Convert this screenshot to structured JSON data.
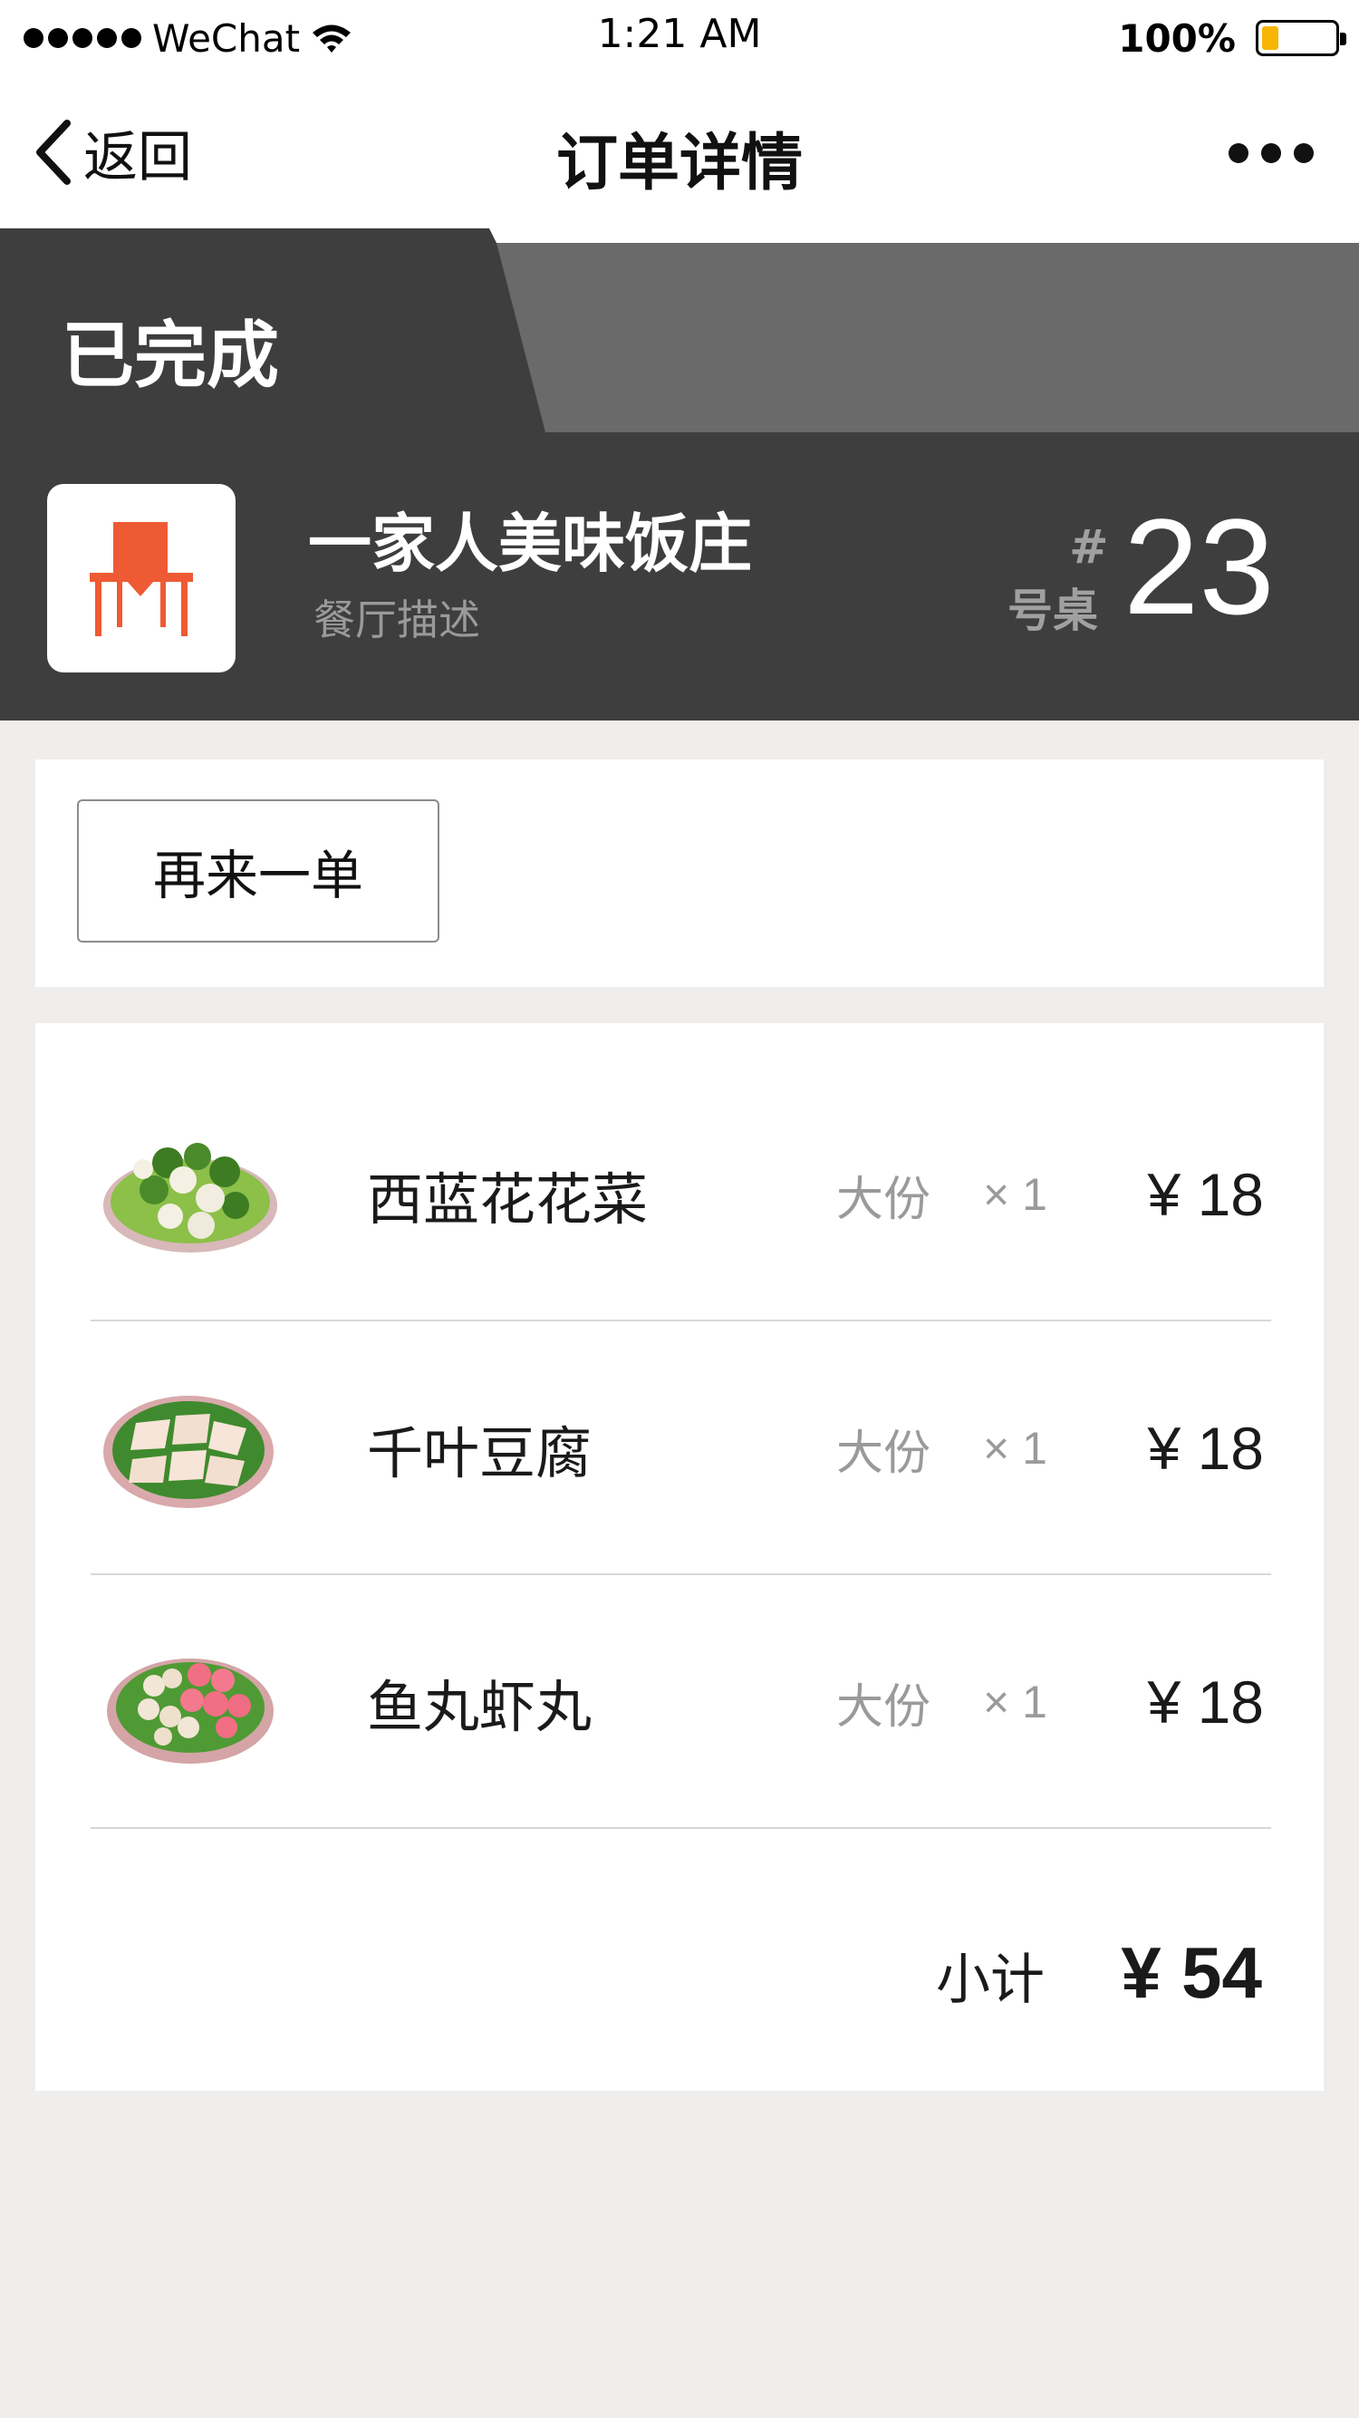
{
  "status_bar": {
    "carrier": "WeChat",
    "time": "1:21 AM",
    "battery_percent": "100%",
    "signal_icon": "signal-dots-icon",
    "wifi_icon": "wifi-icon",
    "battery_icon": "battery-icon"
  },
  "nav": {
    "back_label": "返回",
    "title": "订单详情",
    "back_icon": "chevron-left-icon",
    "more_icon": "more-dots-icon"
  },
  "order": {
    "status": "已完成",
    "restaurant_name": "一家人美味饭庄",
    "restaurant_desc": "餐厅描述",
    "table_hash": "#",
    "table_label": "号桌",
    "table_number": "23",
    "reorder_label": "再来一单",
    "items": [
      {
        "name": "西蓝花花菜",
        "size": "大份",
        "qty": "× 1",
        "price": "¥ 18",
        "image": "broccoli-cauliflower-plate"
      },
      {
        "name": "千叶豆腐",
        "size": "大份",
        "qty": "× 1",
        "price": "¥ 18",
        "image": "tofu-plate"
      },
      {
        "name": "鱼丸虾丸",
        "size": "大份",
        "qty": "× 1",
        "price": "¥ 18",
        "image": "fishball-shrimpball-plate"
      }
    ],
    "subtotal_label": "小计",
    "subtotal_value": "¥ 54"
  },
  "colors": {
    "header_dark": "#3e3e3e",
    "header_light": "#6a6a6a",
    "logo_accent": "#ee5a34",
    "battery_fill": "#f7b500",
    "page_background": "#f0eeed"
  }
}
